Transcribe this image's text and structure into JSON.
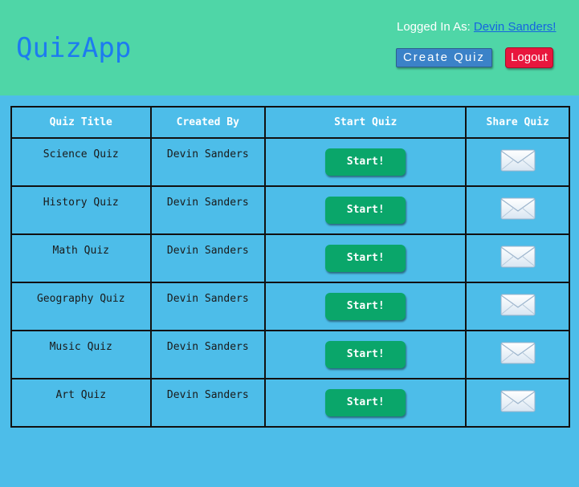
{
  "header": {
    "logo": "QuizApp",
    "logged_in_prefix": "Logged In As: ",
    "user_link": "Devin Sanders!",
    "create_quiz_label": "Create Quiz",
    "logout_label": "Logout"
  },
  "table": {
    "headers": [
      "Quiz Title",
      "Created By",
      "Start Quiz",
      "Share Quiz"
    ],
    "rows": [
      {
        "title": "Science Quiz",
        "author": "Devin Sanders",
        "start_label": "Start!",
        "share_icon": "envelope-icon"
      },
      {
        "title": "History Quiz",
        "author": "Devin Sanders",
        "start_label": "Start!",
        "share_icon": "envelope-icon"
      },
      {
        "title": "Math Quiz",
        "author": "Devin Sanders",
        "start_label": "Start!",
        "share_icon": "envelope-icon"
      },
      {
        "title": "Geography Quiz",
        "author": "Devin Sanders",
        "start_label": "Start!",
        "share_icon": "envelope-icon"
      },
      {
        "title": "Music Quiz",
        "author": "Devin Sanders",
        "start_label": "Start!",
        "share_icon": "envelope-icon"
      },
      {
        "title": "Art Quiz",
        "author": "Devin Sanders",
        "start_label": "Start!",
        "share_icon": "envelope-icon"
      }
    ]
  },
  "colors": {
    "header_bg": "#4fd6a7",
    "page_bg": "#4dbde9",
    "logo": "#1d7bf0",
    "create_button": "#3b82c8",
    "logout_button": "#e8163d",
    "start_button": "#0aa66a"
  }
}
